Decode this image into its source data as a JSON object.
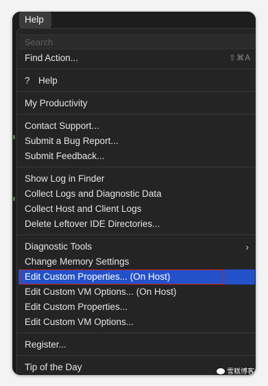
{
  "menubar": {
    "title": "Help"
  },
  "search": {
    "placeholder": "Search"
  },
  "items": {
    "find_action": {
      "label": "Find Action...",
      "shortcut": "⇧⌘A"
    },
    "help": {
      "icon": "?",
      "label": "Help"
    },
    "my_productivity": {
      "label": "My Productivity"
    },
    "contact_support": {
      "label": "Contact Support..."
    },
    "submit_bug": {
      "label": "Submit a Bug Report..."
    },
    "submit_feedback": {
      "label": "Submit Feedback..."
    },
    "show_log": {
      "label": "Show Log in Finder"
    },
    "collect_logs": {
      "label": "Collect Logs and Diagnostic Data"
    },
    "collect_host_logs": {
      "label": "Collect Host and Client Logs"
    },
    "delete_leftover": {
      "label": "Delete Leftover IDE Directories..."
    },
    "diagnostic_tools": {
      "label": "Diagnostic Tools",
      "chevron": "›"
    },
    "change_memory": {
      "label": "Change Memory Settings"
    },
    "edit_props_host": {
      "label": "Edit Custom Properties... (On Host)"
    },
    "edit_vm_host": {
      "label": "Edit Custom VM Options... (On Host)"
    },
    "edit_props": {
      "label": "Edit Custom Properties..."
    },
    "edit_vm": {
      "label": "Edit Custom VM Options..."
    },
    "register": {
      "label": "Register..."
    },
    "tip_of_day": {
      "label": "Tip of the Day"
    }
  },
  "watermark": {
    "text": "雪糕博客",
    "icon": "wechat-icon"
  },
  "colors": {
    "highlight": "#2251c9",
    "outline": "#d42020",
    "menu_bg": "#242424"
  }
}
